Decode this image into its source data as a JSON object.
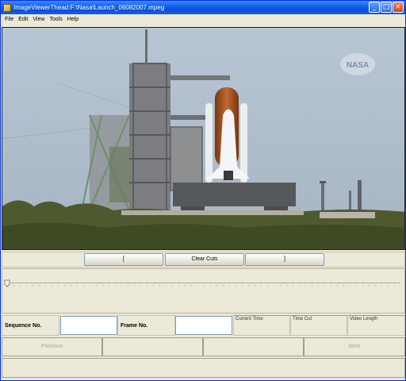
{
  "window": {
    "title": "ImageViewerThead:F:\\Nasa\\Launch_06082007.mpeg",
    "controls": {
      "minimize": "_",
      "maximize": "□",
      "close": "×"
    }
  },
  "menu": [
    "File",
    "Edit",
    "View",
    "Tools",
    "Help"
  ],
  "video": {
    "watermark": "NASA"
  },
  "cut_controls": {
    "mark_in": "[",
    "clear_cuts": "Clear Cuts",
    "mark_out": "]"
  },
  "timeline": {
    "position": 0
  },
  "info": {
    "sequence_label": "Sequence No.",
    "sequence_value": "",
    "frame_label": "Frame No.",
    "frame_value": "",
    "current_time_label": "Current Time",
    "time_cut_label": "Time Cut",
    "video_length_label": "Video Length"
  },
  "navigation": {
    "previous": "Previous",
    "blank1": "",
    "blank2": "",
    "next": "Next"
  },
  "status": {
    "text": ""
  }
}
